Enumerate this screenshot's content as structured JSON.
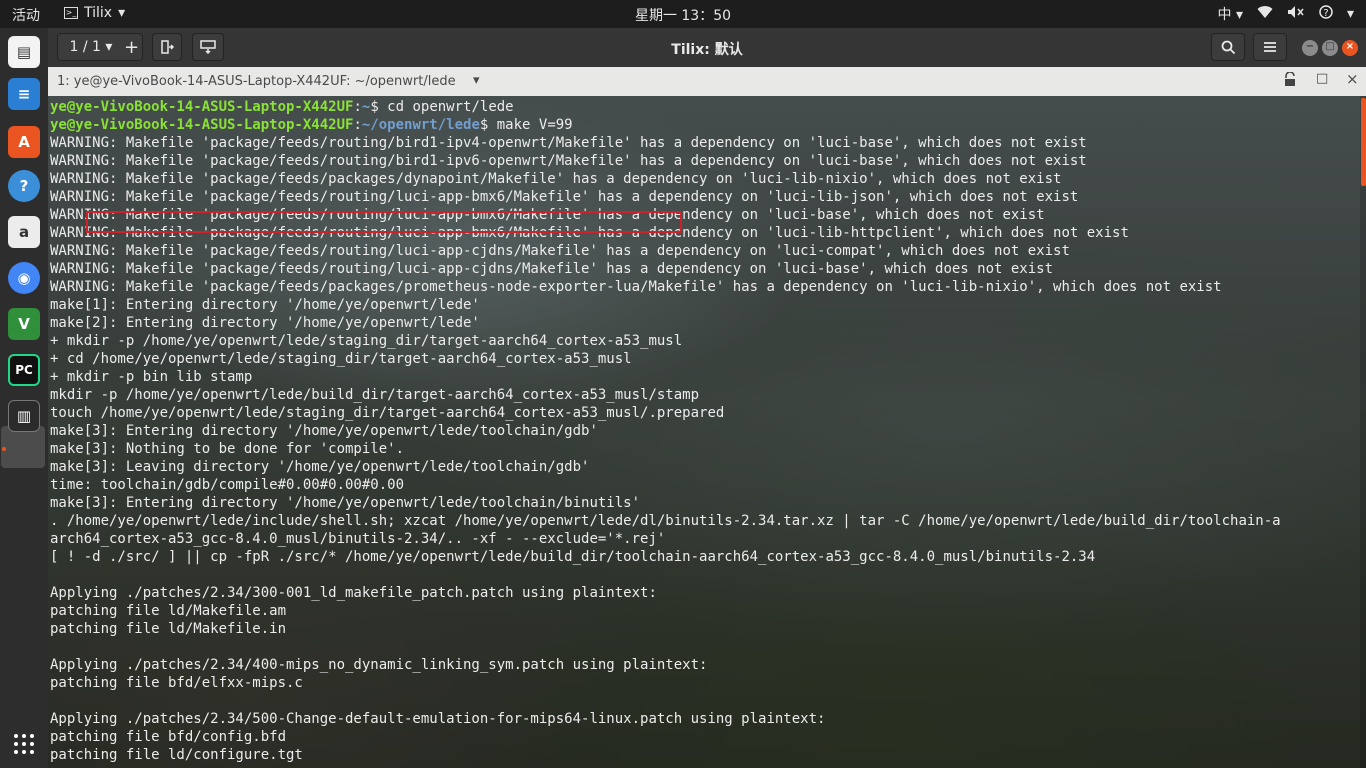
{
  "topbar": {
    "activities": "活动",
    "app_name": "Tilix",
    "app_menu_arrow": "▾",
    "clock": "星期一 13：50",
    "input_method": "中",
    "input_arrow": "▾",
    "network_icon": "wifi-icon",
    "volume_icon": "volume-muted-icon",
    "help_icon": "help-icon",
    "tray_arrow": "▾"
  },
  "dock": {
    "items": [
      {
        "name": "files-icon",
        "glyph": "▤",
        "color": "#f3f3f3"
      },
      {
        "name": "writer-icon",
        "glyph": "≡",
        "color": "#2a7fd4"
      },
      {
        "name": "software-center-icon",
        "glyph": "A",
        "color": "#e95420"
      },
      {
        "name": "help-icon",
        "glyph": "?",
        "color": "#3b8fd8"
      },
      {
        "name": "amazon-icon",
        "glyph": "a",
        "color": "#ececec"
      },
      {
        "name": "chrome-icon",
        "glyph": "◉",
        "color": "#4285f4"
      },
      {
        "name": "vim-icon",
        "glyph": "V",
        "color": "#2f8f3a"
      },
      {
        "name": "pycharm-icon",
        "glyph": "PC",
        "color": "#111111"
      },
      {
        "name": "tilix-icon",
        "glyph": "▥",
        "color": "#2b2b2b"
      }
    ],
    "apps_grid": "⋮⋮"
  },
  "window": {
    "session_counter": "1 / 1",
    "add_label": "+",
    "title": "Tilix: 默认",
    "tab_title": "1: ye@ye-VivoBook-14-ASUS-Laptop-X442UF: ~/openwrt/lede",
    "tab_arrow": "▾"
  },
  "terminal": {
    "prompt_user": "ye@ye-VivoBook-14-ASUS-Laptop-X442UF",
    "prompt_home": "~",
    "prompt_path": "~/openwrt/lede",
    "cmd1": "cd openwrt/lede",
    "cmd2": "make V=99",
    "output": [
      "WARNING: Makefile 'package/feeds/routing/bird1-ipv4-openwrt/Makefile' has a dependency on 'luci-base', which does not exist",
      "WARNING: Makefile 'package/feeds/routing/bird1-ipv6-openwrt/Makefile' has a dependency on 'luci-base', which does not exist",
      "WARNING: Makefile 'package/feeds/packages/dynapoint/Makefile' has a dependency on 'luci-lib-nixio', which does not exist",
      "WARNING: Makefile 'package/feeds/routing/luci-app-bmx6/Makefile' has a dependency on 'luci-lib-json', which does not exist",
      "WARNING: Makefile 'package/feeds/routing/luci-app-bmx6/Makefile' has a dependency on 'luci-base', which does not exist",
      "WARNING: Makefile 'package/feeds/routing/luci-app-bmx6/Makefile' has a dependency on 'luci-lib-httpclient', which does not exist",
      "WARNING: Makefile 'package/feeds/routing/luci-app-cjdns/Makefile' has a dependency on 'luci-compat', which does not exist",
      "WARNING: Makefile 'package/feeds/routing/luci-app-cjdns/Makefile' has a dependency on 'luci-base', which does not exist",
      "WARNING: Makefile 'package/feeds/packages/prometheus-node-exporter-lua/Makefile' has a dependency on 'luci-lib-nixio', which does not exist",
      "make[1]: Entering directory '/home/ye/openwrt/lede'",
      "make[2]: Entering directory '/home/ye/openwrt/lede'",
      "+ mkdir -p /home/ye/openwrt/lede/staging_dir/target-aarch64_cortex-a53_musl",
      "+ cd /home/ye/openwrt/lede/staging_dir/target-aarch64_cortex-a53_musl",
      "+ mkdir -p bin lib stamp",
      "mkdir -p /home/ye/openwrt/lede/build_dir/target-aarch64_cortex-a53_musl/stamp",
      "touch /home/ye/openwrt/lede/staging_dir/target-aarch64_cortex-a53_musl/.prepared",
      "make[3]: Entering directory '/home/ye/openwrt/lede/toolchain/gdb'",
      "make[3]: Nothing to be done for 'compile'.",
      "make[3]: Leaving directory '/home/ye/openwrt/lede/toolchain/gdb'",
      "time: toolchain/gdb/compile#0.00#0.00#0.00",
      "make[3]: Entering directory '/home/ye/openwrt/lede/toolchain/binutils'",
      ". /home/ye/openwrt/lede/include/shell.sh; xzcat /home/ye/openwrt/lede/dl/binutils-2.34.tar.xz | tar -C /home/ye/openwrt/lede/build_dir/toolchain-a",
      "arch64_cortex-a53_gcc-8.4.0_musl/binutils-2.34/.. -xf - --exclude='*.rej'",
      "[ ! -d ./src/ ] || cp -fpR ./src/* /home/ye/openwrt/lede/build_dir/toolchain-aarch64_cortex-a53_gcc-8.4.0_musl/binutils-2.34",
      "",
      "Applying ./patches/2.34/300-001_ld_makefile_patch.patch using plaintext:",
      "patching file ld/Makefile.am",
      "patching file ld/Makefile.in",
      "",
      "Applying ./patches/2.34/400-mips_no_dynamic_linking_sym.patch using plaintext:",
      "patching file bfd/elfxx-mips.c",
      "",
      "Applying ./patches/2.34/500-Change-default-emulation-for-mips64-linux.patch using plaintext:",
      "patching file bfd/config.bfd",
      "patching file ld/configure.tgt"
    ]
  }
}
